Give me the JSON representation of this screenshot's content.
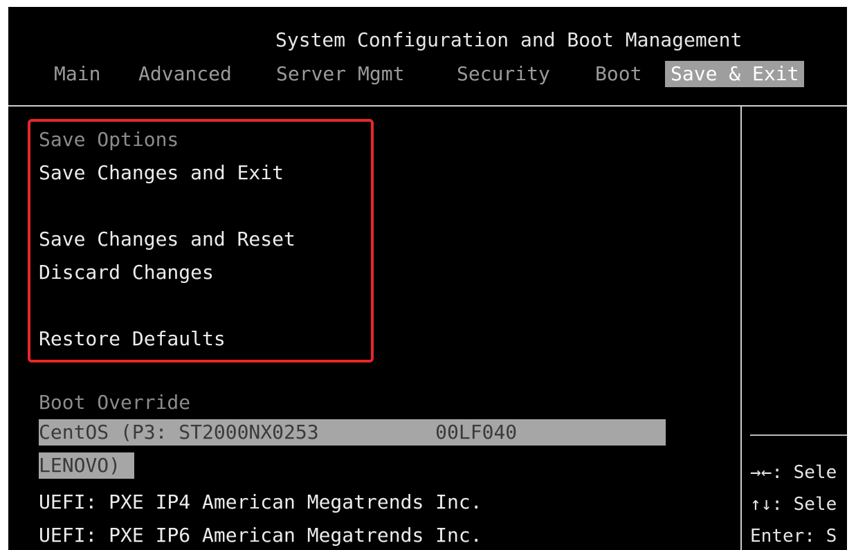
{
  "title": "System Configuration and Boot Management",
  "tabs": [
    "Main",
    "Advanced",
    "Server Mgmt",
    "Security",
    "Boot",
    "Save & Exit"
  ],
  "active_tab": "Save & Exit",
  "save_options": {
    "header": "Save Options",
    "items": [
      "Save Changes and Exit",
      "Save Changes and Reset",
      "Discard Changes",
      "Restore Defaults"
    ]
  },
  "boot_override": {
    "header": "Boot Override",
    "selected_line1": "CentOS (P3: ST2000NX0253          00LF040",
    "selected_line2": "LENOVO)",
    "items": [
      "UEFI: PXE IP4 American Megatrends Inc.",
      "UEFI: PXE IP6 American Megatrends Inc."
    ]
  },
  "help": {
    "line1": "→←: Sele",
    "line2": "↑↓: Sele",
    "line3": "Enter: S"
  },
  "colors": {
    "background": "#000000",
    "text": "#ececec",
    "dim_text": "#8c8c8c",
    "active_tab_bg": "#9e9e9e",
    "highlight_bg": "#a6a6a6",
    "annotation_border": "#e8262a"
  }
}
